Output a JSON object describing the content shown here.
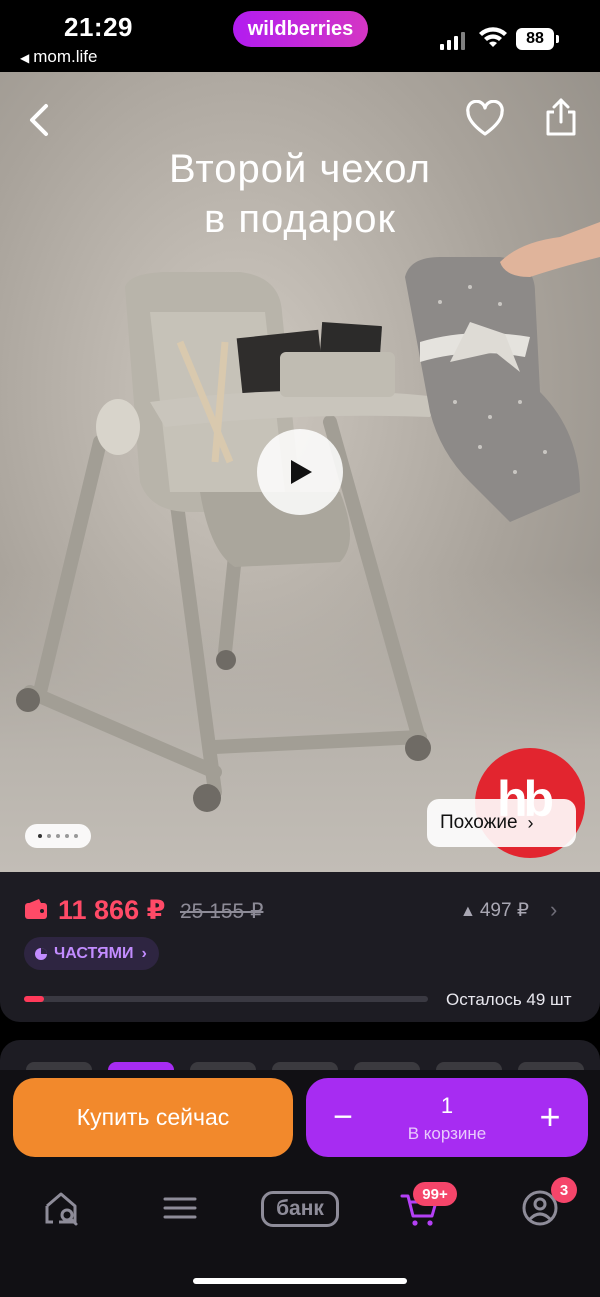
{
  "status_bar": {
    "time": "21:29",
    "back_app": "mom.life",
    "center_pill": "wildberries",
    "battery": "88"
  },
  "hero": {
    "title_line1": "Второй чехол",
    "title_line2": "в подарок",
    "brand_logo": "hb",
    "similar_label": "Похожие",
    "slide_count": 5,
    "active_slide": 1,
    "icons": [
      "back-arrow-icon",
      "heart-icon",
      "share-icon",
      "play-icon"
    ]
  },
  "price": {
    "current": "11 866 ₽",
    "old": "25 155 ₽",
    "change": "497 ₽",
    "installments_label": "ЧАСТЯМИ",
    "stock_text": "Осталось 49 шт",
    "stock_fill_fraction": 0.05,
    "price_color": "#ff4a67"
  },
  "actions": {
    "buy_now": "Купить сейчас",
    "cart_qty": "1",
    "cart_label": "В корзине",
    "buy_color": "#f2892c",
    "cart_color": "#a72cf2"
  },
  "tab_bar": {
    "items": [
      {
        "name": "search-home",
        "icon": "home-search-icon"
      },
      {
        "name": "catalog",
        "icon": "menu-icon"
      },
      {
        "name": "bank",
        "label": "банк"
      },
      {
        "name": "cart",
        "icon": "cart-icon",
        "badge": "99+"
      },
      {
        "name": "profile",
        "icon": "profile-icon",
        "badge": "3"
      }
    ]
  }
}
